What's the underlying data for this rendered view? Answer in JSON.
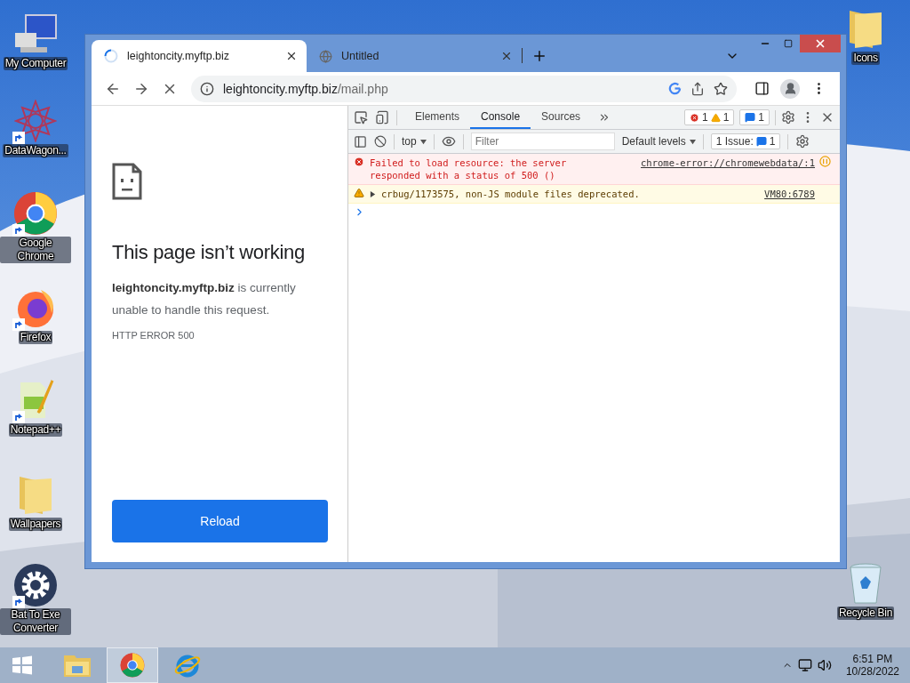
{
  "desktop_icons_left": [
    {
      "label": "My Computer",
      "kind": "computer",
      "shortcut": false
    },
    {
      "label": "DataWagon...",
      "kind": "datawagon",
      "shortcut": true
    },
    {
      "label": "Google Chrome",
      "kind": "chrome",
      "shortcut": true
    },
    {
      "label": "Firefox",
      "kind": "firefox",
      "shortcut": true
    },
    {
      "label": "Notepad++",
      "kind": "notepad",
      "shortcut": true
    },
    {
      "label": "Wallpapers",
      "kind": "folder",
      "shortcut": false
    },
    {
      "label": "Bat To Exe Converter",
      "kind": "gear",
      "shortcut": true
    }
  ],
  "desktop_icons_right": [
    {
      "label": "Icons",
      "kind": "folder",
      "shortcut": false
    },
    {
      "label": "Recycle Bin",
      "kind": "recycle",
      "shortcut": false
    }
  ],
  "browser": {
    "tabs": [
      {
        "title": "leightoncity.myftp.biz",
        "kind": "loading",
        "selected": true
      },
      {
        "title": "Untitled",
        "kind": "globe",
        "selected": false
      }
    ],
    "address": {
      "host": "leightoncity.myftp.biz",
      "path": "/mail.php"
    },
    "page": {
      "heading": "This page isn’t working",
      "message": "**leightoncity.myftp.biz** is currently unable to handle this request.",
      "error_code": "HTTP ERROR 500",
      "button": "Reload"
    },
    "devtools": {
      "tabs": [
        {
          "label": "Elements",
          "selected": false
        },
        {
          "label": "Console",
          "selected": true
        },
        {
          "label": "Sources",
          "selected": false
        }
      ],
      "error_count": "1",
      "warning_count": "1",
      "info_count": "1",
      "context": "top",
      "filter_placeholder": "Filter",
      "levels": "Default levels",
      "issues_label": "1 Issue:",
      "issues_count": "1",
      "messages": [
        {
          "kind": "error",
          "text": "Failed to load resource: the server responded with a status of 500 ()",
          "source": "chrome-error://chromewebdata/:1"
        },
        {
          "kind": "warning",
          "text": "crbug/1173575, non-JS module files deprecated.",
          "source": "VM80:6789"
        }
      ]
    }
  },
  "taskbar": {
    "apps": [
      {
        "kind": "explorer",
        "selected": false
      },
      {
        "kind": "chrome",
        "selected": true
      },
      {
        "kind": "ie",
        "selected": false
      }
    ],
    "time": "6:51 PM",
    "date": "10/28/2022"
  }
}
